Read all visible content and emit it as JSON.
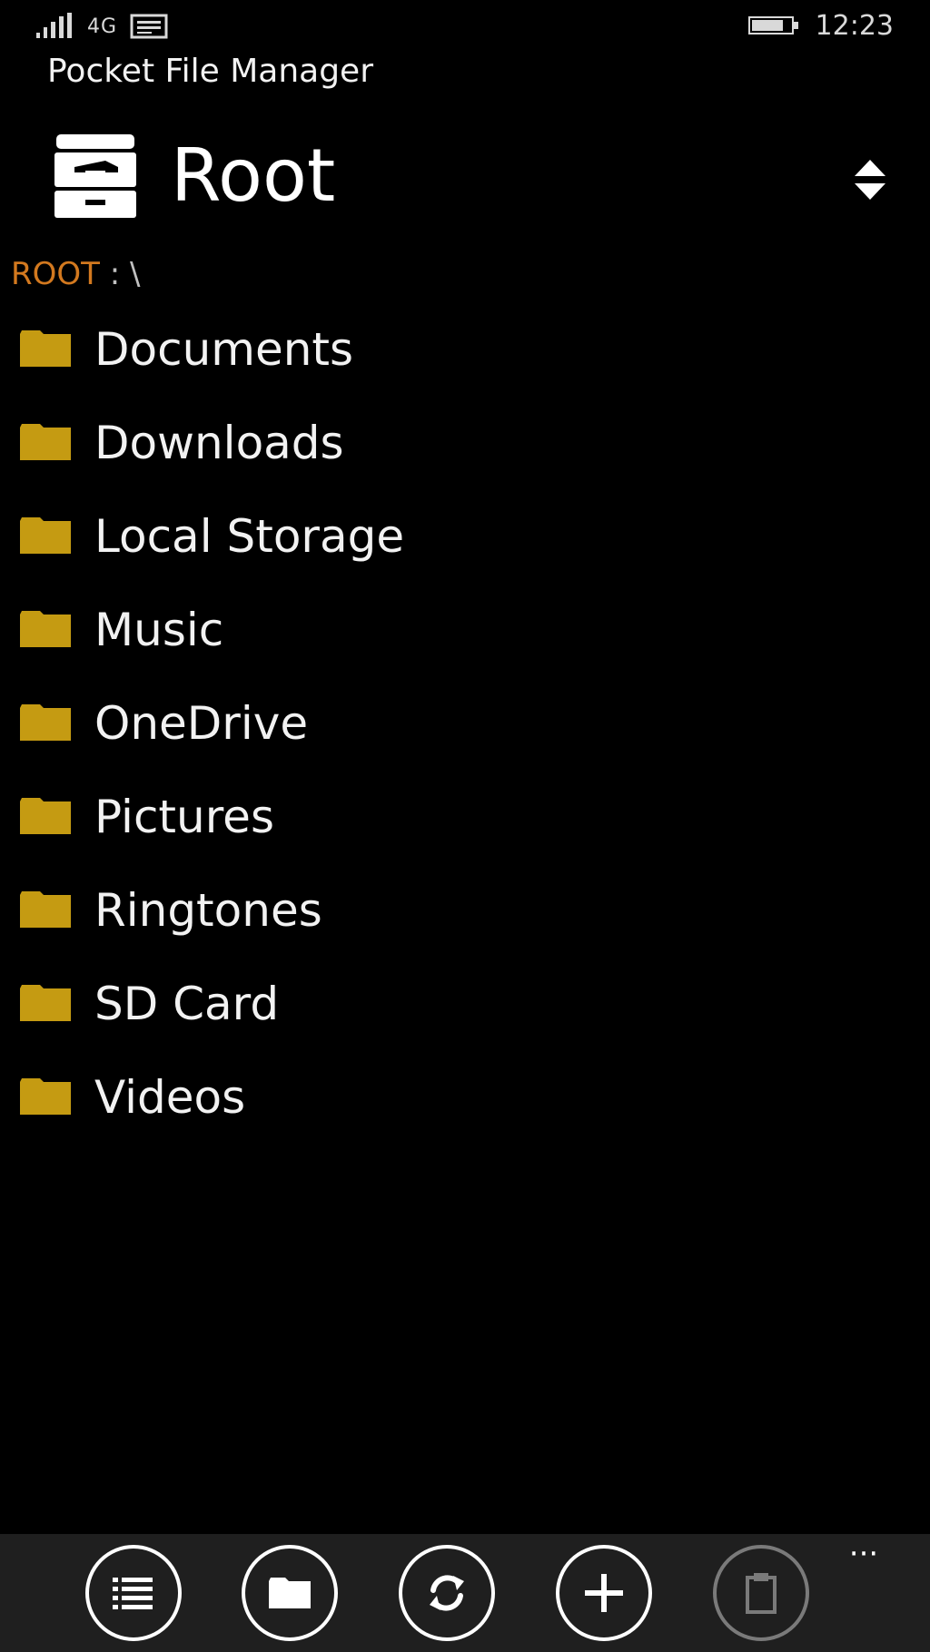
{
  "status_bar": {
    "network": "4G",
    "time": "12:23"
  },
  "app": {
    "title": "Pocket File Manager"
  },
  "header": {
    "title": "Root"
  },
  "breadcrumb": {
    "root": "ROOT",
    "separator": " : ",
    "path": "\\"
  },
  "folders": [
    {
      "name": "Documents"
    },
    {
      "name": "Downloads"
    },
    {
      "name": "Local Storage"
    },
    {
      "name": "Music"
    },
    {
      "name": "OneDrive"
    },
    {
      "name": "Pictures"
    },
    {
      "name": "Ringtones"
    },
    {
      "name": "SD Card"
    },
    {
      "name": "Videos"
    }
  ],
  "app_bar": {
    "more": "···"
  },
  "colors": {
    "folder": "#c59b12",
    "breadcrumb_root": "#d3791f",
    "background": "#000000",
    "app_bar": "#1f1f1f"
  },
  "icons": {
    "header": "file-cabinet-icon",
    "sort": "sort-icon",
    "folder": "folder-icon",
    "buttons": [
      "list-icon",
      "folder-icon",
      "refresh-icon",
      "add-icon",
      "paste-icon"
    ]
  }
}
